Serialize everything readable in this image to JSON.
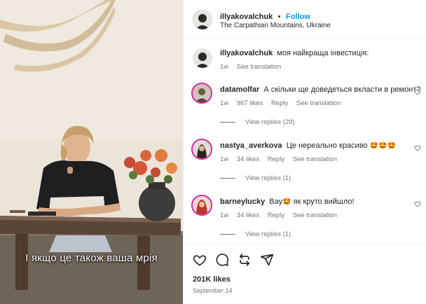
{
  "media": {
    "subtitle": "І якщо це також ваша мрія"
  },
  "header": {
    "username": "illyakovalchuk",
    "dot": "•",
    "follow_label": "Follow",
    "location": "The Carpathian Mountains, Ukraine"
  },
  "caption": {
    "username": "illyakovalchuk",
    "text": "моя найкраща інвестиція:",
    "age": "1w",
    "see_translation": "See translation"
  },
  "comments": [
    {
      "username": "datamolfar",
      "text": "А скільки ще доведеться вкласти в ремонт?",
      "age": "1w",
      "likes": "967 likes",
      "reply": "Reply",
      "see_translation": "See translation",
      "view_replies": "View replies (29)"
    },
    {
      "username": "nastya_averkova",
      "text": "Це нереально красиво",
      "emoji": "🤩🤩🤩",
      "age": "1w",
      "likes": "34 likes",
      "reply": "Reply",
      "see_translation": "See translation",
      "view_replies": "View replies (1)"
    },
    {
      "username": "barneylucky",
      "text_pre": "Вау",
      "emoji": "🤩",
      "text_post": "як круто вийшло!",
      "age": "1w",
      "likes": "34 likes",
      "reply": "Reply",
      "see_translation": "See translation",
      "view_replies": "View replies (1)"
    }
  ],
  "footer": {
    "likes": "201K likes",
    "date": "September 14"
  },
  "icons": {
    "like": "heart-icon",
    "comment": "comment-icon",
    "share": "repost-icon",
    "send": "send-icon"
  },
  "colors": {
    "follow_blue": "#0095f6",
    "meta_gray": "#737373",
    "story_ring": "#d6249f"
  }
}
